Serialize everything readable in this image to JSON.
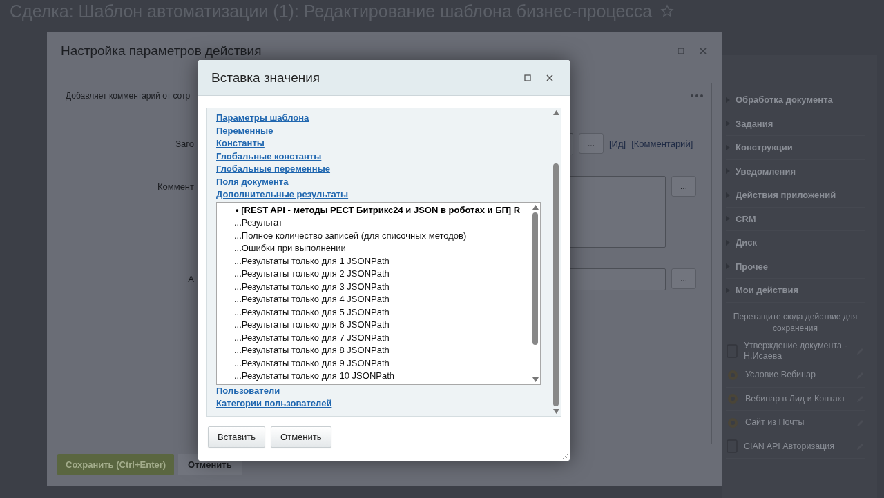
{
  "page": {
    "title": "Сделка: Шаблон автоматизации (1): Редактирование шаблона бизнес-процесса"
  },
  "action_dialog": {
    "title": "Настройка параметров действия",
    "description": "Добавляет комментарий от сотр",
    "fields": [
      {
        "label": "Заго",
        "kind": "line",
        "button": "...",
        "links": [
          "[Ид]",
          "[Комментарий]"
        ]
      },
      {
        "label": "Коммент",
        "kind": "area",
        "button": "..."
      },
      {
        "label": "А",
        "kind": "short",
        "button": "..."
      }
    ],
    "buttons": [
      {
        "label": "Сохранить (Ctrl+Enter)",
        "kind": "primary"
      },
      {
        "label": "Отменить",
        "kind": "secondary"
      }
    ]
  },
  "sidebar": {
    "groups": [
      "Обработка документа",
      "Задания",
      "Конструкции",
      "Уведомления",
      "Действия приложений",
      "CRM",
      "Диск",
      "Прочее",
      "Мои действия"
    ],
    "drop_hint": "Перетащите сюда действие для сохранения",
    "my_actions": [
      {
        "label": "Утверждение документа - Н.Исаева",
        "kind": "document"
      },
      {
        "label": "Условие Вебинар",
        "kind": "gear"
      },
      {
        "label": "Вебинар в Лид и Контакт",
        "kind": "gear"
      },
      {
        "label": "Сайт из Почты",
        "kind": "gear"
      },
      {
        "label": "CIAN API Авторизация",
        "kind": "document"
      }
    ]
  },
  "insert_dialog": {
    "title": "Вставка значения",
    "sections": [
      "Параметры шаблона",
      "Переменные",
      "Константы",
      "Глобальные константы",
      "Глобальные переменные",
      "Поля документа",
      "Дополнительные результаты"
    ],
    "results_list": {
      "header": "• [REST API - методы РЕСТ Битрикс24 и JSON в роботах и БП] R",
      "items": [
        "...Результат",
        "...Полное количество записей (для списочных методов)",
        "...Ошибки при выполнении",
        "...Результаты только для 1 JSONPath",
        "...Результаты только для 2 JSONPath",
        "...Результаты только для 3 JSONPath",
        "...Результаты только для 4 JSONPath",
        "...Результаты только для 5 JSONPath",
        "...Результаты только для 6 JSONPath",
        "...Результаты только для 7 JSONPath",
        "...Результаты только для 8 JSONPath",
        "...Результаты только для 9 JSONPath",
        "...Результаты только для 10 JSONPath"
      ]
    },
    "sections_after": [
      "Пользователи",
      "Категории пользователей"
    ],
    "buttons": [
      "Вставить",
      "Отменить"
    ]
  }
}
